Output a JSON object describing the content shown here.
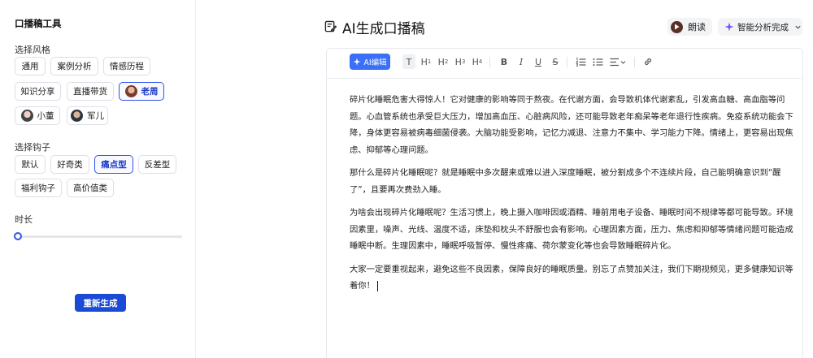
{
  "sidebar": {
    "title": "口播稿工具",
    "style_label": "选择风格",
    "styles": [
      "通用",
      "案例分析",
      "情感历程",
      "知识分享",
      "直播带货",
      "老周",
      "小董",
      "军儿"
    ],
    "hook_label": "选择钩子",
    "hooks": [
      "默认",
      "好奇类",
      "痛点型",
      "反差型",
      "福利钩子",
      "高价值类"
    ],
    "duration_label": "时长",
    "duration_value": 0,
    "regenerate_label": "重新生成"
  },
  "header": {
    "title": "AI生成口播稿",
    "read_label": "朗读",
    "smart_label": "智能分析完成"
  },
  "toolbar": {
    "ai_edit_label": "AI编辑",
    "text": "T",
    "h": "H",
    "h1": "1",
    "h2": "2",
    "h3": "3",
    "h4": "4",
    "bold": "B",
    "italic": "I",
    "underline": "U",
    "strike": "S"
  },
  "content": {
    "paragraphs": [
      "碎片化睡眠危害大得惊人！它对健康的影响等同于熬夜。在代谢方面，会导致机体代谢紊乱，引发高血糖、高血脂等问题。心血管系统也承受巨大压力，增加高血压、心脏病风险，还可能导致老年痴呆等老年退行性疾病。免疫系统功能会下降，身体更容易被病毒细菌侵袭。大脑功能受影响，记忆力减退、注意力不集中、学习能力下降。情绪上，更容易出现焦虑、抑郁等心理问题。",
      "那什么是碎片化睡眠呢？就是睡眠中多次醒来或难以进入深度睡眠，被分割成多个不连续片段，自己能明确意识到“醒了”，且要再次费劲入睡。",
      "为啥会出现碎片化睡眠呢？生活习惯上，晚上摄入咖啡因或酒精、睡前用电子设备、睡眠时间不规律等都可能导致。环境因素里，噪声、光线、温度不适，床垫和枕头不舒服也会有影响。心理因素方面，压力、焦虑和抑郁等情绪问题可能造成睡眠中断。生理因素中，睡眠呼吸暂停、慢性疼痛、荷尔蒙变化等也会导致睡眠碎片化。",
      "大家一定要重视起来，避免这些不良因素，保障良好的睡眠质量。别忘了点赞加关注，我们下期视频见，更多健康知识等着你！"
    ]
  },
  "colors": {
    "accent": "#2f54eb",
    "primary_button": "#1a4ad6",
    "ai_button": "#3b6ff5"
  },
  "state": {
    "selected_style": "老周",
    "selected_hook": "痛点型"
  }
}
